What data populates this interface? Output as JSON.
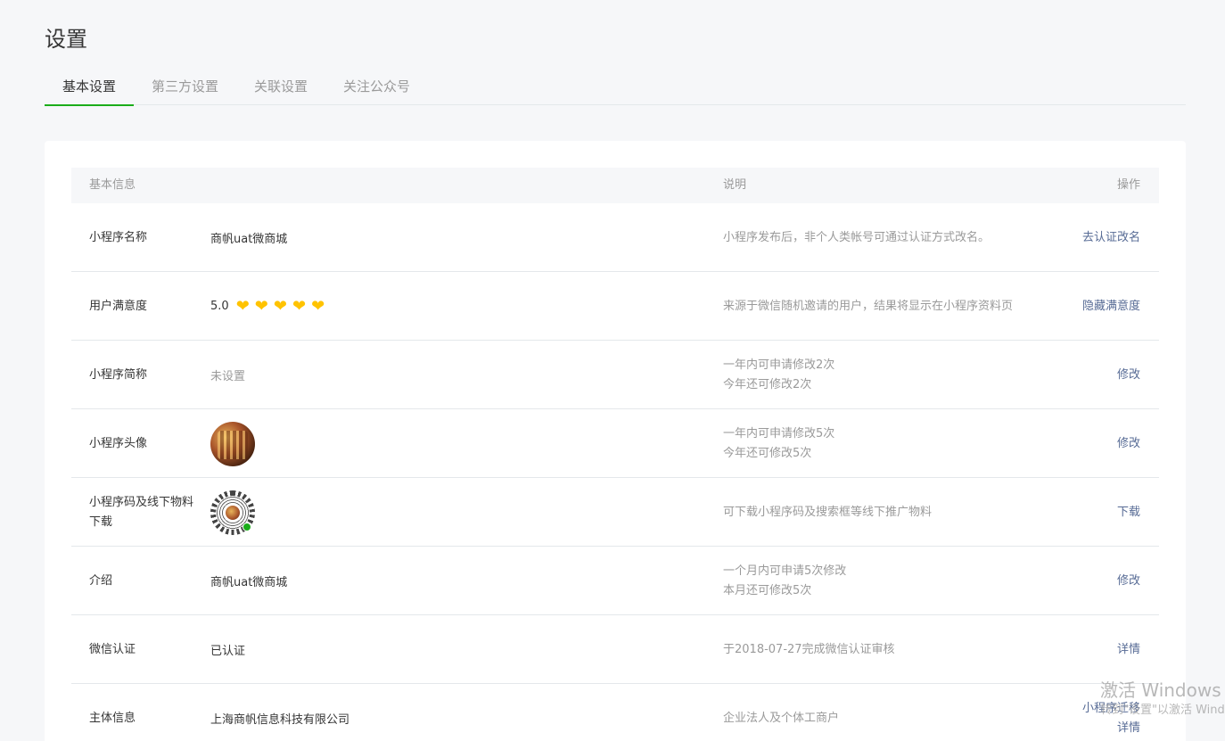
{
  "page": {
    "title": "设置"
  },
  "tabs": [
    {
      "label": "基本设置",
      "active": true
    },
    {
      "label": "第三方设置",
      "active": false
    },
    {
      "label": "关联设置",
      "active": false
    },
    {
      "label": "关注公众号",
      "active": false
    }
  ],
  "table": {
    "headers": {
      "info": "基本信息",
      "desc": "说明",
      "op": "操作"
    },
    "rows": [
      {
        "label": "小程序名称",
        "value": "商帆uat微商城",
        "desc": [
          "小程序发布后，非个人类帐号可通过认证方式改名。"
        ],
        "ops": [
          "去认证改名"
        ]
      },
      {
        "label": "用户满意度",
        "value": "5.0",
        "hearts": 5,
        "desc": [
          "来源于微信随机邀请的用户，结果将显示在小程序资料页"
        ],
        "ops": [
          "隐藏满意度"
        ]
      },
      {
        "label": "小程序简称",
        "value": "未设置",
        "desc": [
          "一年内可申请修改2次",
          "今年还可修改2次"
        ],
        "ops": [
          "修改"
        ]
      },
      {
        "label": "小程序头像",
        "image": "avatar",
        "desc": [
          "一年内可申请修改5次",
          "今年还可修改5次"
        ],
        "ops": [
          "修改"
        ]
      },
      {
        "label": "小程序码及线下物料下载",
        "image": "qrcode",
        "desc": [
          "可下载小程序码及搜索框等线下推广物料"
        ],
        "ops": [
          "下载"
        ]
      },
      {
        "label": "介绍",
        "value": "商帆uat微商城",
        "desc": [
          "一个月内可申请5次修改",
          "本月还可修改5次"
        ],
        "ops": [
          "修改"
        ]
      },
      {
        "label": "微信认证",
        "value": "已认证",
        "desc": [
          "于2018-07-27完成微信认证审核"
        ],
        "ops": [
          "详情"
        ]
      },
      {
        "label": "主体信息",
        "value": "上海商帆信息科技有限公司",
        "desc": [
          "企业法人及个体工商户"
        ],
        "ops": [
          "小程序迁移",
          "详情"
        ]
      }
    ]
  },
  "watermark": {
    "title": "激活 Windows",
    "subtitle": "转到\"设置\"以激活 Windows。"
  },
  "colors": {
    "accent": "#1aad19",
    "link": "#576b95",
    "heart": "#ffc300",
    "muted": "#9a9a9a"
  }
}
